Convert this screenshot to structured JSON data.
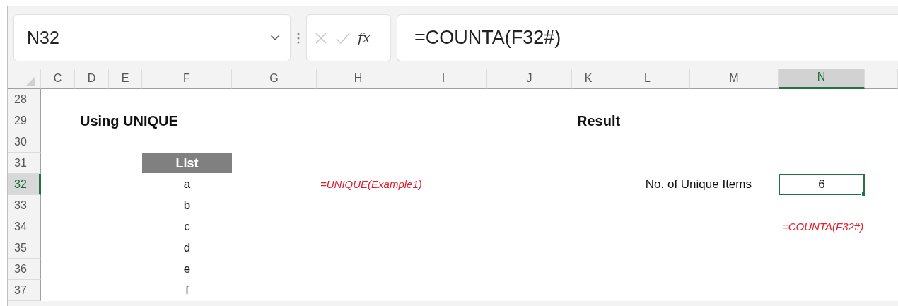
{
  "name_box": {
    "value": "N32"
  },
  "formula_bar": {
    "function_label": "fx",
    "value": "=COUNTA(F32#)"
  },
  "columns": [
    {
      "label": "C",
      "selected": false
    },
    {
      "label": "D",
      "selected": false
    },
    {
      "label": "E",
      "selected": false
    },
    {
      "label": "F",
      "selected": false
    },
    {
      "label": "G",
      "selected": false
    },
    {
      "label": "H",
      "selected": false
    },
    {
      "label": "I",
      "selected": false
    },
    {
      "label": "J",
      "selected": false
    },
    {
      "label": "K",
      "selected": false
    },
    {
      "label": "L",
      "selected": false
    },
    {
      "label": "M",
      "selected": false
    },
    {
      "label": "N",
      "selected": true
    }
  ],
  "rows": [
    {
      "label": "28",
      "selected": false,
      "cells": []
    },
    {
      "label": "29",
      "selected": false,
      "cells": [
        {
          "kind": "heading",
          "text": "Using UNIQUE",
          "selected": false
        },
        {
          "kind": "heading",
          "text": "Result",
          "selected": false
        }
      ]
    },
    {
      "label": "30",
      "selected": false,
      "cells": []
    },
    {
      "label": "31",
      "selected": false,
      "cells": [
        {
          "kind": "table_header",
          "text": "List",
          "selected": false
        }
      ]
    },
    {
      "label": "32",
      "selected": true,
      "cells": [
        {
          "kind": "value",
          "text": "a",
          "selected": false
        },
        {
          "kind": "note",
          "text": "=UNIQUE(Example1)",
          "selected": false
        },
        {
          "kind": "label",
          "text": "No. of Unique Items",
          "selected": false
        },
        {
          "kind": "value",
          "text": "6",
          "selected": true
        }
      ]
    },
    {
      "label": "33",
      "selected": false,
      "cells": [
        {
          "kind": "value",
          "text": "b",
          "selected": false
        }
      ]
    },
    {
      "label": "34",
      "selected": false,
      "cells": [
        {
          "kind": "value",
          "text": "c",
          "selected": false
        },
        {
          "kind": "note",
          "text": "=COUNTA(F32#)",
          "selected": false
        }
      ]
    },
    {
      "label": "35",
      "selected": false,
      "cells": [
        {
          "kind": "value",
          "text": "d",
          "selected": false
        }
      ]
    },
    {
      "label": "36",
      "selected": false,
      "cells": [
        {
          "kind": "value",
          "text": "e",
          "selected": false
        }
      ]
    },
    {
      "label": "37",
      "selected": false,
      "cells": [
        {
          "kind": "value",
          "text": "f",
          "selected": false
        }
      ]
    }
  ]
}
